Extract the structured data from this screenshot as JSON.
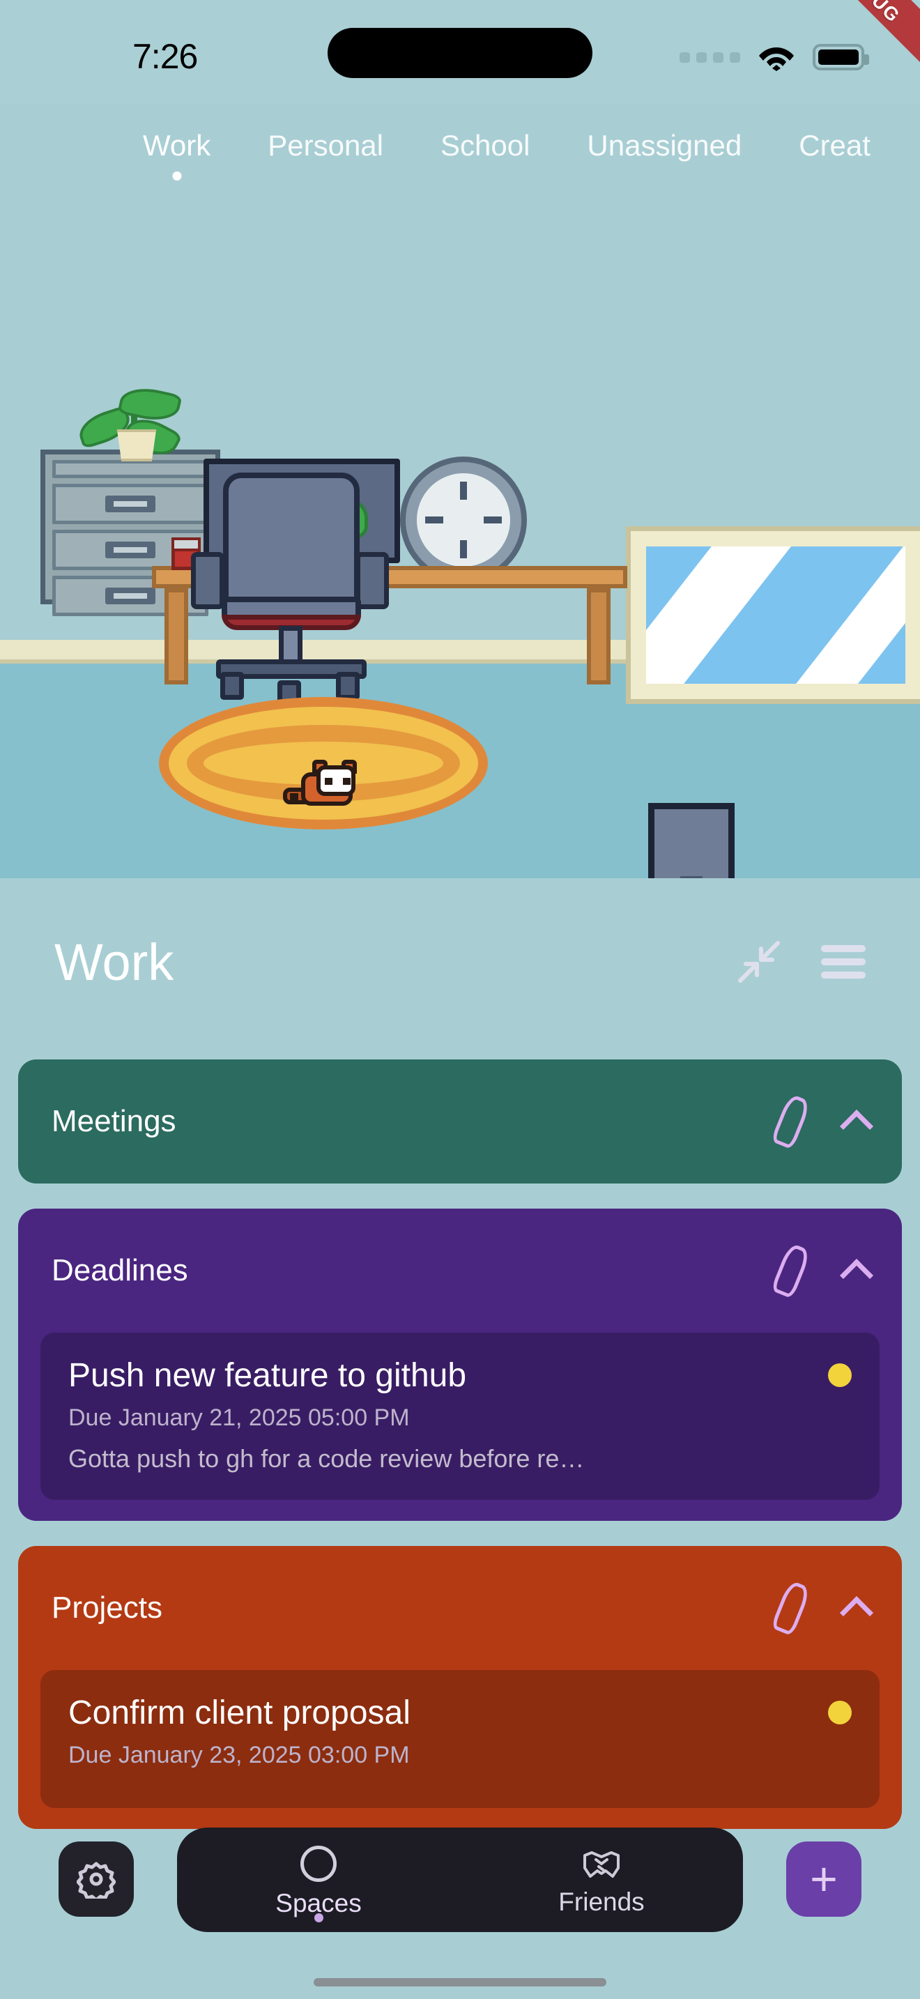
{
  "status_bar": {
    "time": "7:26",
    "cellular_icon": "cellular-dots-icon",
    "wifi_icon": "wifi-icon",
    "battery_icon": "battery-icon",
    "debug_label": "DEBUG"
  },
  "tabs": [
    {
      "label": "Work",
      "active": true
    },
    {
      "label": "Personal",
      "active": false
    },
    {
      "label": "School",
      "active": false
    },
    {
      "label": "Unassigned",
      "active": false
    },
    {
      "label": "Creat",
      "active": false
    }
  ],
  "scene": {
    "description": "pixel-art home office room",
    "wall_color": "#a8cdd3",
    "floor_color": "#86c0cc",
    "items": [
      "wall-clock",
      "window-mirror",
      "filing-cabinet",
      "potted-plant",
      "desk",
      "coffee-mug",
      "desk-plant",
      "monitor",
      "office-chair",
      "pc-tower",
      "round-rug",
      "red-panda-pet"
    ]
  },
  "list_header": {
    "title": "Work",
    "collapse_icon": "collapse-arrows-icon",
    "menu_icon": "hamburger-menu-icon"
  },
  "categories": [
    {
      "name": "Meetings",
      "color": "#2c6b60",
      "edit_icon": "pencil-icon",
      "collapse_icon": "chevron-up-icon",
      "tasks": []
    },
    {
      "name": "Deadlines",
      "color": "#4a2680",
      "edit_icon": "pencil-icon",
      "collapse_icon": "chevron-up-icon",
      "tasks": [
        {
          "title": "Push new feature to github",
          "due": "Due January 21, 2025 05:00 PM",
          "description": "Gotta push to gh for a code review before re…",
          "priority_color": "#f2d33c"
        }
      ]
    },
    {
      "name": "Projects",
      "color": "#b43a14",
      "edit_icon": "pencil-icon",
      "collapse_icon": "chevron-up-icon",
      "tasks": [
        {
          "title": "Confirm client proposal",
          "due": "Due January 23, 2025 03:00 PM",
          "description": "",
          "priority_color": "#f2d33c"
        }
      ]
    }
  ],
  "bottom_nav": {
    "settings_icon": "gear-icon",
    "add_icon": "plus-icon",
    "add_label": "+",
    "items": [
      {
        "label": "Spaces",
        "icon": "moon-icon",
        "active": true
      },
      {
        "label": "Friends",
        "icon": "handshake-icon",
        "active": false
      }
    ]
  }
}
